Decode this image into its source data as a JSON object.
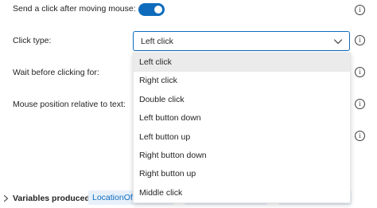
{
  "settings": {
    "send_click": {
      "label": "Send a click after moving mouse:",
      "enabled": true
    },
    "click_type": {
      "label": "Click type:",
      "value": "Left click",
      "options": [
        "Left click",
        "Right click",
        "Double click",
        "Left button down",
        "Left button up",
        "Right button down",
        "Right button up",
        "Middle click"
      ]
    },
    "wait_before": {
      "label": "Wait before clicking for:"
    },
    "mouse_position": {
      "label": "Mouse position relative to text:"
    }
  },
  "info_glyph": "i",
  "footer": {
    "label": "Variables produced",
    "variables": [
      "LocationOfTextOnScreenX"
    ]
  },
  "colors": {
    "accent": "#0f6cbd",
    "selected_option_bg": "#ebebeb",
    "variable_chip_bg": "#e8f1fb"
  }
}
